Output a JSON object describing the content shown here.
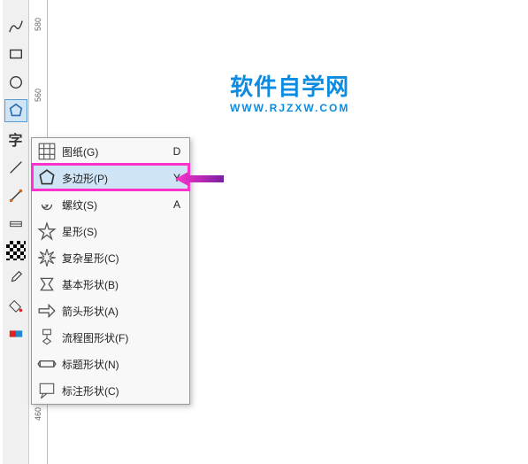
{
  "ruler": {
    "ticks": [
      "580",
      "560",
      "460"
    ]
  },
  "toolbar": {
    "tools": [
      {
        "name": "freehand-tool"
      },
      {
        "name": "rectangle-tool"
      },
      {
        "name": "ellipse-tool"
      },
      {
        "name": "polygon-tool",
        "selected": true
      },
      {
        "name": "text-tool",
        "glyph": "字"
      },
      {
        "name": "line-tool"
      },
      {
        "name": "connector-tool"
      },
      {
        "name": "dimension-tool"
      },
      {
        "name": "checker-tool"
      },
      {
        "name": "eyedropper-tool"
      },
      {
        "name": "fill-tool"
      },
      {
        "name": "blend-tool"
      }
    ]
  },
  "flyout": {
    "items": [
      {
        "name": "graph-paper",
        "label": "图纸(G)",
        "key": "D"
      },
      {
        "name": "polygon",
        "label": "多边形(P)",
        "key": "Y",
        "hover": true
      },
      {
        "name": "spiral",
        "label": "螺纹(S)",
        "key": "A"
      },
      {
        "name": "star",
        "label": "星形(S)",
        "key": ""
      },
      {
        "name": "complex-star",
        "label": "复杂星形(C)",
        "key": ""
      },
      {
        "name": "basic-shapes",
        "label": "基本形状(B)",
        "key": ""
      },
      {
        "name": "arrow-shapes",
        "label": "箭头形状(A)",
        "key": ""
      },
      {
        "name": "flowchart-shapes",
        "label": "流程图形状(F)",
        "key": ""
      },
      {
        "name": "banner-shapes",
        "label": "标题形状(N)",
        "key": ""
      },
      {
        "name": "callout-shapes",
        "label": "标注形状(C)",
        "key": ""
      }
    ]
  },
  "watermark": {
    "line1": "软件自学网",
    "line2": "WWW.RJZXW.COM"
  }
}
